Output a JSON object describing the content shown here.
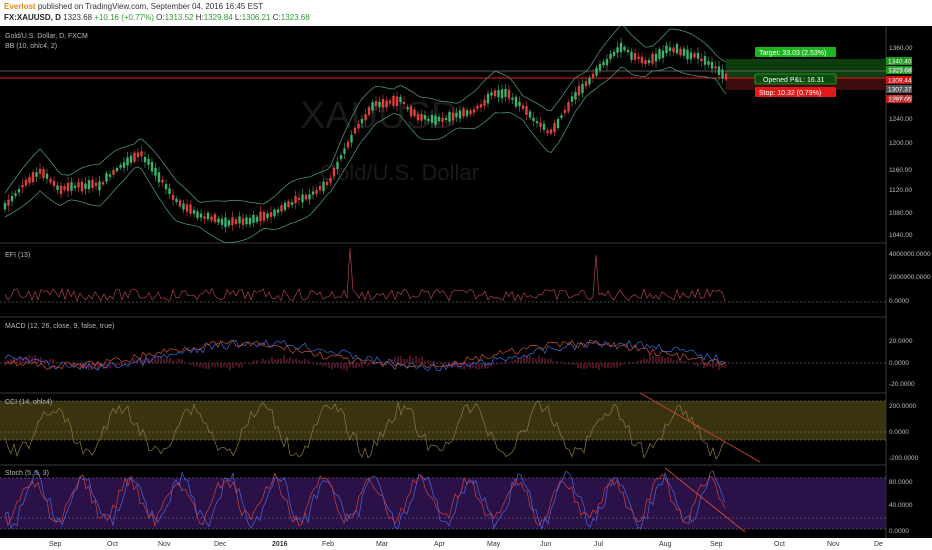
{
  "header": {
    "author": "Everlost",
    "published": "published on TradingView.com, September 04, 2016 16:45 EST",
    "symbol": "FX:XAUUSD, D",
    "last": "1323.68",
    "change": "+10.16 (+0.77%)",
    "o_label": "O:",
    "o": "1313.52",
    "h_label": "H:",
    "h": "1329.84",
    "l_label": "L:",
    "l": "1306.21",
    "c_label": "C:",
    "c": "1323.68"
  },
  "watermark": {
    "symbol": "XAUUSD",
    "name": "Gold/U.S. Dollar"
  },
  "main_pane": {
    "title": "Gold/U.S. Dollar, D, FXCM",
    "indicator": "BB (10, ohlc4, 2)",
    "y_ticks": [
      "1360.00",
      "1320.00",
      "1280.00",
      "1240.00",
      "1200.00",
      "1160.00",
      "1120.00",
      "1080.00",
      "1040.00"
    ],
    "price_tags": [
      {
        "text": "1340.40",
        "color": "#1e9a1e"
      },
      {
        "text": "1323.68",
        "color": "#1e9a1e"
      },
      {
        "text": "1309.44",
        "color": "#c81818"
      },
      {
        "text": "1307.37",
        "color": "#555555"
      },
      {
        "text": "1297.05",
        "color": "#c81818"
      }
    ],
    "position": {
      "target": "Target: 33.03 (2.53%)",
      "opened": "Opened P&L: 16.31",
      "stop": "Stop: 10.32 (0.79%)",
      "target_color": "#1eb41e",
      "stop_color": "#e11919"
    }
  },
  "efi_pane": {
    "title": "EFI (13)",
    "y_ticks": [
      "4000000.0000",
      "2000000.0000",
      "0.0000"
    ]
  },
  "macd_pane": {
    "title": "MACD (12, 26, close, 9, false, true)",
    "y_ticks": [
      "20.0000",
      "0.0000",
      "-20.0000"
    ]
  },
  "cci_pane": {
    "title": "CCI (14, ohlc4)",
    "y_ticks": [
      "200.0000",
      "0.0000",
      "-200.0000"
    ]
  },
  "stoch_pane": {
    "title": "Stoch (5, 5, 3)",
    "y_ticks": [
      "80.0000",
      "40.0000",
      "0.0000"
    ]
  },
  "time_axis": [
    "Sep",
    "Oct",
    "Nov",
    "Dec",
    "2016",
    "Feb",
    "Mar",
    "Apr",
    "May",
    "Jun",
    "Jul",
    "Aug",
    "Sep",
    "Oct",
    "Nov",
    "De"
  ],
  "colors": {
    "background": "#000000",
    "candle_up": "#3cb46e",
    "candle_down": "#e04040",
    "bb_band": "#4a8f78",
    "hline": "#e01e1e"
  }
}
